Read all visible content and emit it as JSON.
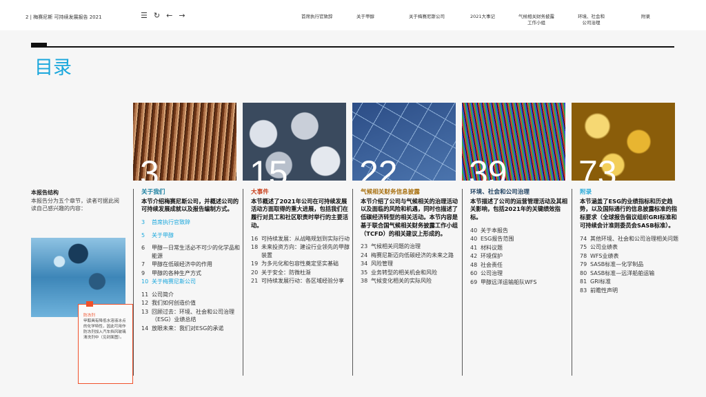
{
  "header": {
    "page": "2 | 梅赛尼斯 可持续发展报告 2021",
    "tools": [
      "menu-icon",
      "reset-icon",
      "back-arrow-icon",
      "forward-arrow-icon"
    ],
    "nav": [
      "首席执行官致辞",
      "关于甲醇",
      "关于梅赛尼斯公司",
      "2021大事记",
      "气候相关财务披露\n工作小组",
      "环境、社会和\n公司治理",
      "附录"
    ]
  },
  "title": "目录",
  "intro": {
    "heading": "本报告结构",
    "text": "本报告分为五个章节，读者可据此阅读自己感兴趣的内容："
  },
  "callout": {
    "title": "防冻剂",
    "text": "甲醇具有降低水溶液冰点的化学特性，因此可用作防冻剂加入汽车挡风玻璃清洗剂中（见封面图）。"
  },
  "sections": [
    {
      "number": "3",
      "title": "关于我们",
      "color": "#1a7fa0",
      "desc": "本节介绍梅赛尼斯公司，并概述公司的可持续发展成就以及报告编制方式。",
      "items": [
        {
          "n": "3",
          "t": "首席执行官致辞",
          "hl": true
        },
        {
          "n": "5",
          "t": "关于甲醇",
          "hl": true
        },
        {
          "n": "6",
          "t": "甲醇—日常生活必不可少的化学品和能源"
        },
        {
          "n": "7",
          "t": "甲醇在低碳经济中的作用"
        },
        {
          "n": "9",
          "t": "甲醇的各种生产方式"
        },
        {
          "n": "10",
          "t": "关于梅赛尼斯公司",
          "hl": true
        },
        {
          "n": "11",
          "t": "公司简介"
        },
        {
          "n": "12",
          "t": "我们如何创造价值"
        },
        {
          "n": "13",
          "t": "回顾过去：环境、社会和公司治理（ESG）业绩总结"
        },
        {
          "n": "14",
          "t": "放眼未来：我们对ESG的承诺"
        }
      ]
    },
    {
      "number": "15",
      "title": "大事件",
      "color": "#c8401c",
      "desc": "本节概述了2021年公司在可持续发展活动方面取得的重大进展，包括我们在履行对员工和社区职责时举行的主要活动。",
      "items": [
        {
          "n": "16",
          "t": "可持续发展：从战略规划到实际行动"
        },
        {
          "n": "18",
          "t": "未来投资方向：建设行业领先的甲醇装置"
        },
        {
          "n": "19",
          "t": "为多元化和包容性奠定坚实基础"
        },
        {
          "n": "20",
          "t": "关于安全：防微杜渐"
        },
        {
          "n": "21",
          "t": "可持续发展行动：各区域经验分享"
        }
      ]
    },
    {
      "number": "22",
      "title": "气候相关财务信息披露",
      "color": "#a8700f",
      "desc": "本节介绍了公司与气候相关的治理活动以及面临的风险和机遇，同时也描述了低碳经济转型的相关活动。本节内容是基于联合国气候相关财务披露工作小组（TCFD）的相关建议上形成的。",
      "items": [
        {
          "n": "23",
          "t": "气候相关问题的治理"
        },
        {
          "n": "24",
          "t": "梅赛尼斯迈向低碳经济的未来之路"
        },
        {
          "n": "34",
          "t": "风险管理"
        },
        {
          "n": "35",
          "t": "业务转型的相关机会和风险"
        },
        {
          "n": "38",
          "t": "气候变化相关的实际风险"
        }
      ]
    },
    {
      "number": "39",
      "title": "环境、社会和公司治理",
      "color": "#1d3f5f",
      "desc": "本节描述了公司的运营管理活动及其相关影响，包括2021年的关键绩效指标。",
      "items": [
        {
          "n": "40",
          "t": "关于本报告"
        },
        {
          "n": "40",
          "t": "ESG报告范围"
        },
        {
          "n": "41",
          "t": "材料议题"
        },
        {
          "n": "42",
          "t": "环境保护"
        },
        {
          "n": "48",
          "t": "社会责任"
        },
        {
          "n": "60",
          "t": "公司治理"
        },
        {
          "n": "69",
          "t": "甲醇远洋运输船队WFS"
        }
      ]
    },
    {
      "number": "73",
      "title": "附录",
      "color": "#29a9d8",
      "desc": "本节涵盖了ESG的业绩指标和历史趋势，以及国际通行的信息披露标准的指标要求（全球报告倡议组织GRI标准和可持续会计准则委员会SASB标准）。",
      "items": [
        {
          "n": "74",
          "t": "其他环境、社会和公司治理相关问题"
        },
        {
          "n": "75",
          "t": "公司业绩表"
        },
        {
          "n": "78",
          "t": "WFS业绩表"
        },
        {
          "n": "79",
          "t": "SASB标准—化学制品"
        },
        {
          "n": "80",
          "t": "SASB标准—远洋船舶运输"
        },
        {
          "n": "81",
          "t": "GRI标准"
        },
        {
          "n": "83",
          "t": "前瞻性声明"
        }
      ]
    }
  ]
}
